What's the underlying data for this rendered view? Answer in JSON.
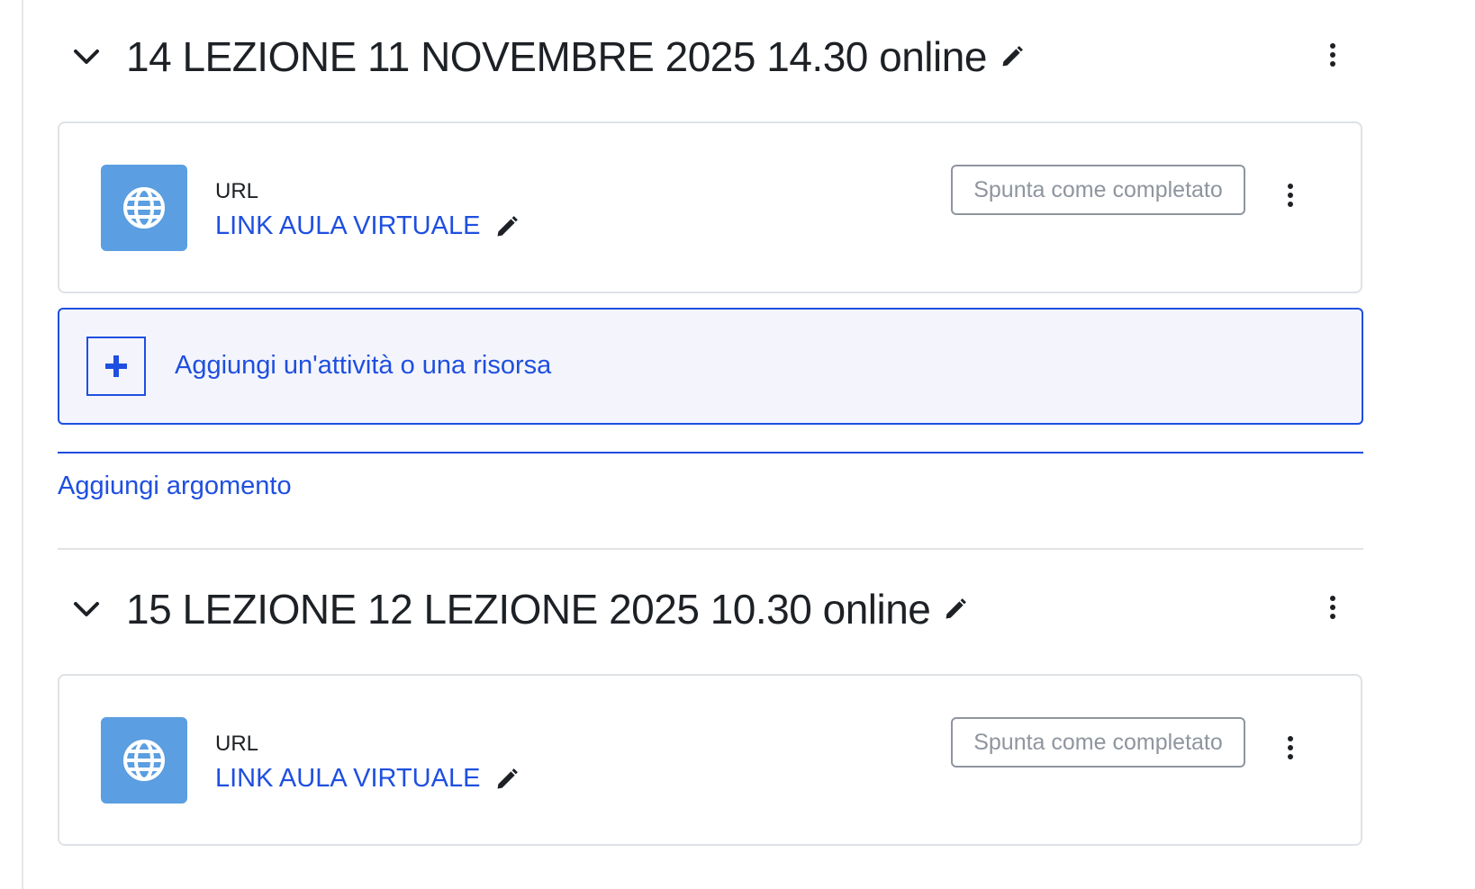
{
  "sections": [
    {
      "title": "14 LEZIONE 11 NOVEMBRE 2025 14.30 online",
      "activity": {
        "type_label": "URL",
        "link_label": "LINK AULA VIRTUALE",
        "icon": "globe-icon",
        "complete_label": "Spunta come completato"
      }
    },
    {
      "title": "15 LEZIONE 12 LEZIONE 2025 10.30 online",
      "activity": {
        "type_label": "URL",
        "link_label": "LINK AULA VIRTUALE",
        "icon": "globe-icon",
        "complete_label": "Spunta come completato"
      }
    }
  ],
  "add_activity_label": "Aggiungi un'attività o una risorsa",
  "add_topic_label": "Aggiungi argomento",
  "colors": {
    "link": "#1f4fe0",
    "icon_bg": "#5b9ee1",
    "add_bg": "#f4f5fc",
    "text": "#1d2125",
    "muted": "#8f959e"
  }
}
